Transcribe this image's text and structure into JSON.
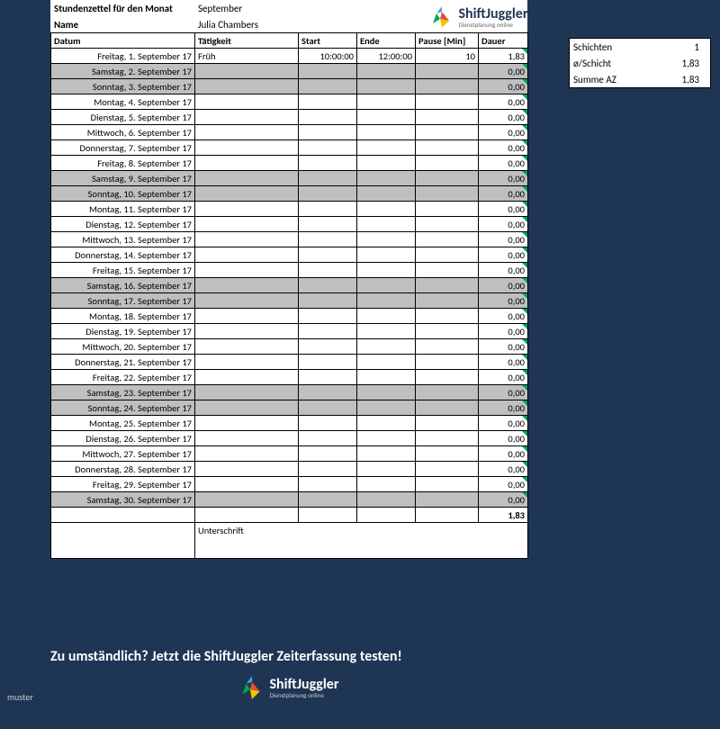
{
  "meta": {
    "title_label": "Stundenzettel für den Monat",
    "month": "September",
    "name_label": "Name",
    "name": "Julia Chambers"
  },
  "logo": {
    "brand": "ShiftJuggler",
    "tagline": "Dienstplanung online"
  },
  "headers": {
    "datum": "Datum",
    "taetigkeit": "Tätigkeit",
    "start": "Start",
    "ende": "Ende",
    "pause": "Pause [Min]",
    "dauer": "Dauer"
  },
  "rows": [
    {
      "datum": "Freitag, 1. September 17",
      "taet": "Früh",
      "start": "10:00:00",
      "ende": "12:00:00",
      "pause": "10",
      "dauer": "1,83",
      "weekend": false
    },
    {
      "datum": "Samstag, 2. September 17",
      "taet": "",
      "start": "",
      "ende": "",
      "pause": "",
      "dauer": "0,00",
      "weekend": true
    },
    {
      "datum": "Sonntag, 3. September 17",
      "taet": "",
      "start": "",
      "ende": "",
      "pause": "",
      "dauer": "0,00",
      "weekend": true
    },
    {
      "datum": "Montag, 4. September 17",
      "taet": "",
      "start": "",
      "ende": "",
      "pause": "",
      "dauer": "0,00",
      "weekend": false
    },
    {
      "datum": "Dienstag, 5. September 17",
      "taet": "",
      "start": "",
      "ende": "",
      "pause": "",
      "dauer": "0,00",
      "weekend": false
    },
    {
      "datum": "Mittwoch, 6. September 17",
      "taet": "",
      "start": "",
      "ende": "",
      "pause": "",
      "dauer": "0,00",
      "weekend": false
    },
    {
      "datum": "Donnerstag, 7. September 17",
      "taet": "",
      "start": "",
      "ende": "",
      "pause": "",
      "dauer": "0,00",
      "weekend": false
    },
    {
      "datum": "Freitag, 8. September 17",
      "taet": "",
      "start": "",
      "ende": "",
      "pause": "",
      "dauer": "0,00",
      "weekend": false
    },
    {
      "datum": "Samstag, 9. September 17",
      "taet": "",
      "start": "",
      "ende": "",
      "pause": "",
      "dauer": "0,00",
      "weekend": true
    },
    {
      "datum": "Sonntag, 10. September 17",
      "taet": "",
      "start": "",
      "ende": "",
      "pause": "",
      "dauer": "0,00",
      "weekend": true
    },
    {
      "datum": "Montag, 11. September 17",
      "taet": "",
      "start": "",
      "ende": "",
      "pause": "",
      "dauer": "0,00",
      "weekend": false
    },
    {
      "datum": "Dienstag, 12. September 17",
      "taet": "",
      "start": "",
      "ende": "",
      "pause": "",
      "dauer": "0,00",
      "weekend": false
    },
    {
      "datum": "Mittwoch, 13. September 17",
      "taet": "",
      "start": "",
      "ende": "",
      "pause": "",
      "dauer": "0,00",
      "weekend": false
    },
    {
      "datum": "Donnerstag, 14. September 17",
      "taet": "",
      "start": "",
      "ende": "",
      "pause": "",
      "dauer": "0,00",
      "weekend": false
    },
    {
      "datum": "Freitag, 15. September 17",
      "taet": "",
      "start": "",
      "ende": "",
      "pause": "",
      "dauer": "0,00",
      "weekend": false
    },
    {
      "datum": "Samstag, 16. September 17",
      "taet": "",
      "start": "",
      "ende": "",
      "pause": "",
      "dauer": "0,00",
      "weekend": true
    },
    {
      "datum": "Sonntag, 17. September 17",
      "taet": "",
      "start": "",
      "ende": "",
      "pause": "",
      "dauer": "0,00",
      "weekend": true
    },
    {
      "datum": "Montag, 18. September 17",
      "taet": "",
      "start": "",
      "ende": "",
      "pause": "",
      "dauer": "0,00",
      "weekend": false
    },
    {
      "datum": "Dienstag, 19. September 17",
      "taet": "",
      "start": "",
      "ende": "",
      "pause": "",
      "dauer": "0,00",
      "weekend": false
    },
    {
      "datum": "Mittwoch, 20. September 17",
      "taet": "",
      "start": "",
      "ende": "",
      "pause": "",
      "dauer": "0,00",
      "weekend": false
    },
    {
      "datum": "Donnerstag, 21. September 17",
      "taet": "",
      "start": "",
      "ende": "",
      "pause": "",
      "dauer": "0,00",
      "weekend": false
    },
    {
      "datum": "Freitag, 22. September 17",
      "taet": "",
      "start": "",
      "ende": "",
      "pause": "",
      "dauer": "0,00",
      "weekend": false
    },
    {
      "datum": "Samstag, 23. September 17",
      "taet": "",
      "start": "",
      "ende": "",
      "pause": "",
      "dauer": "0,00",
      "weekend": true
    },
    {
      "datum": "Sonntag, 24. September 17",
      "taet": "",
      "start": "",
      "ende": "",
      "pause": "",
      "dauer": "0,00",
      "weekend": true
    },
    {
      "datum": "Montag, 25. September 17",
      "taet": "",
      "start": "",
      "ende": "",
      "pause": "",
      "dauer": "0,00",
      "weekend": false
    },
    {
      "datum": "Dienstag, 26. September 17",
      "taet": "",
      "start": "",
      "ende": "",
      "pause": "",
      "dauer": "0,00",
      "weekend": false
    },
    {
      "datum": "Mittwoch, 27. September 17",
      "taet": "",
      "start": "",
      "ende": "",
      "pause": "",
      "dauer": "0,00",
      "weekend": false
    },
    {
      "datum": "Donnerstag, 28. September 17",
      "taet": "",
      "start": "",
      "ende": "",
      "pause": "",
      "dauer": "0,00",
      "weekend": false
    },
    {
      "datum": "Freitag, 29. September 17",
      "taet": "",
      "start": "",
      "ende": "",
      "pause": "",
      "dauer": "0,00",
      "weekend": false
    },
    {
      "datum": "Samstag, 30. September 17",
      "taet": "",
      "start": "",
      "ende": "",
      "pause": "",
      "dauer": "0,00",
      "weekend": true
    }
  ],
  "sum": {
    "dauer": "1,83"
  },
  "signature_label": "Unterschrift",
  "stats": {
    "schichten_label": "Schichten",
    "schichten": "1",
    "avg_label": "ø/Schicht",
    "avg": "1,83",
    "sum_label": "Summe AZ",
    "sum": "1,83"
  },
  "cta": {
    "text": "Zu umständlich? Jetzt die ShiftJuggler Zeiterfassung testen!"
  },
  "watermark": "muster"
}
